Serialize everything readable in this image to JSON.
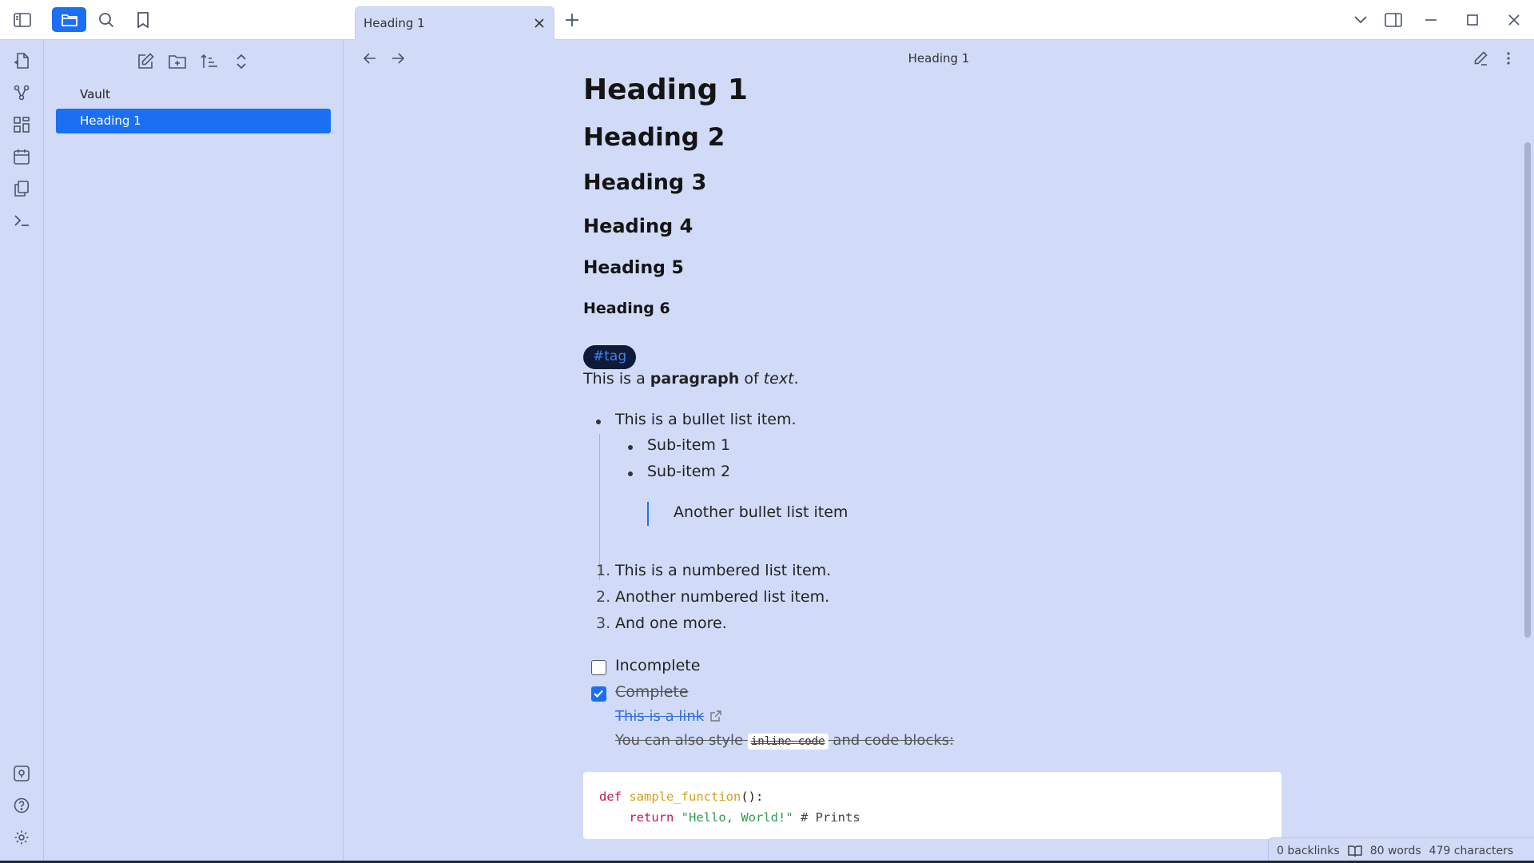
{
  "tab": {
    "title": "Heading 1"
  },
  "view_title": "Heading 1",
  "sidebar": {
    "vault": "Vault",
    "active_file": "Heading 1"
  },
  "doc": {
    "h1": "Heading 1",
    "h2": "Heading 2",
    "h3": "Heading 3",
    "h4": "Heading 4",
    "h5": "Heading 5",
    "h6": "Heading 6",
    "tag": "#tag",
    "para": {
      "a": "This is a ",
      "b": "paragraph",
      "c": " of ",
      "d": "text",
      "e": "."
    },
    "bullet1": "This is a bullet list item.",
    "sub1": "Sub-item 1",
    "sub2": "Sub-item 2",
    "quote": "Another bullet list item",
    "num": [
      "1.",
      "2.",
      "3."
    ],
    "numbered": [
      "This is a numbered list item.",
      "Another numbered list item.",
      "And one more."
    ],
    "task_incomplete": "Incomplete",
    "task_complete": "Complete",
    "link": "This is a link",
    "style_a": "You can also style ",
    "inline_code": "inline code",
    "style_b": " and code blocks:",
    "code": {
      "def": "def",
      "fn": "sample_function",
      "paren": "():",
      "ret": "return",
      "str": "\"Hello, World!\"",
      "comment": "# Prints"
    }
  },
  "status": {
    "backlinks": "0 backlinks",
    "words": "80 words",
    "chars": "479 characters"
  },
  "icons": {
    "ribbon": [
      "sidebar-toggle-icon",
      "open-quick-switcher-icon",
      "graph-icon",
      "canvas-icon",
      "daily-note-icon",
      "templates-icon",
      "command-palette-icon",
      "vault-switcher-icon",
      "help-icon",
      "settings-icon"
    ]
  }
}
